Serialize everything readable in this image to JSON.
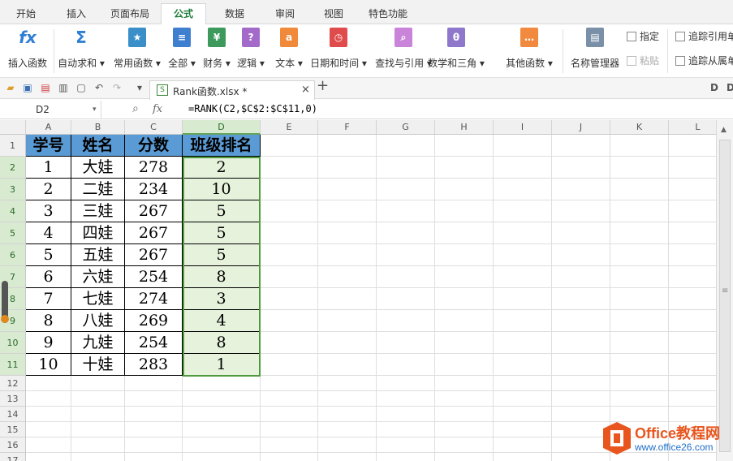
{
  "tabs": [
    "开始",
    "插入",
    "页面布局",
    "公式",
    "数据",
    "审阅",
    "视图",
    "特色功能"
  ],
  "active_tab": "公式",
  "ribbon": {
    "buttons": [
      {
        "label": "插入函数",
        "icon": "fx-icon",
        "glyph": "fx",
        "color": "#2e7fd4"
      },
      {
        "label": "自动求和 ▾",
        "icon": "sigma-icon",
        "glyph": "Σ",
        "color": "#2e7fd4"
      },
      {
        "label": "常用函数 ▾",
        "icon": "star-book-icon",
        "glyph": "★",
        "color": "#3a8fc9"
      },
      {
        "label": "全部 ▾",
        "icon": "list-book-icon",
        "glyph": "≡",
        "color": "#3f7fd0"
      },
      {
        "label": "财务 ▾",
        "icon": "finance-book-icon",
        "glyph": "¥",
        "color": "#3e9a5c"
      },
      {
        "label": "逻辑 ▾",
        "icon": "logic-book-icon",
        "glyph": "?",
        "color": "#a36ac9"
      },
      {
        "label": "文本 ▾",
        "icon": "text-book-icon",
        "glyph": "a",
        "color": "#f08a3a"
      },
      {
        "label": "日期和时间 ▾",
        "icon": "clock-book-icon",
        "glyph": "◷",
        "color": "#e04b4b"
      },
      {
        "label": "查找与引用 ▾",
        "icon": "search-book-icon",
        "glyph": "⌕",
        "color": "#c983d8"
      },
      {
        "label": "数学和三角 ▾",
        "icon": "theta-book-icon",
        "glyph": "θ",
        "color": "#8f78cc"
      },
      {
        "label": "其他函数 ▾",
        "icon": "more-book-icon",
        "glyph": "…",
        "color": "#f18a3e"
      },
      {
        "label": "名称管理器",
        "icon": "name-manager-icon",
        "glyph": "▤",
        "color": "#7a8fa8"
      }
    ],
    "small": [
      "指定",
      "粘贴",
      "追踪引用单",
      "追踪从属单"
    ]
  },
  "doc_tab": {
    "name": "Rank函数.xlsx *"
  },
  "formula_bar": {
    "name_box": "D2",
    "fx": "fx",
    "formula": "=RANK(C2,$C$2:$C$11,0)"
  },
  "columns": [
    "A",
    "B",
    "C",
    "D",
    "E",
    "F",
    "G",
    "H",
    "I",
    "J",
    "K",
    "L"
  ],
  "selected_column": "D",
  "rows": [
    "1",
    "2",
    "3",
    "4",
    "5",
    "6",
    "7",
    "8",
    "9",
    "10",
    "11",
    "12",
    "13",
    "14",
    "15",
    "16",
    "17"
  ],
  "table": {
    "headers": [
      "学号",
      "姓名",
      "分数",
      "班级排名"
    ],
    "data": [
      [
        "1",
        "大娃",
        "278",
        "2"
      ],
      [
        "2",
        "二娃",
        "234",
        "10"
      ],
      [
        "3",
        "三娃",
        "267",
        "5"
      ],
      [
        "4",
        "四娃",
        "267",
        "5"
      ],
      [
        "5",
        "五娃",
        "267",
        "5"
      ],
      [
        "6",
        "六娃",
        "254",
        "8"
      ],
      [
        "7",
        "七娃",
        "274",
        "3"
      ],
      [
        "8",
        "八娃",
        "269",
        "4"
      ],
      [
        "9",
        "九娃",
        "254",
        "8"
      ],
      [
        "10",
        "十娃",
        "283",
        "1"
      ]
    ]
  },
  "watermark": {
    "brand": "Office教程网",
    "url": "www.office26.com"
  }
}
